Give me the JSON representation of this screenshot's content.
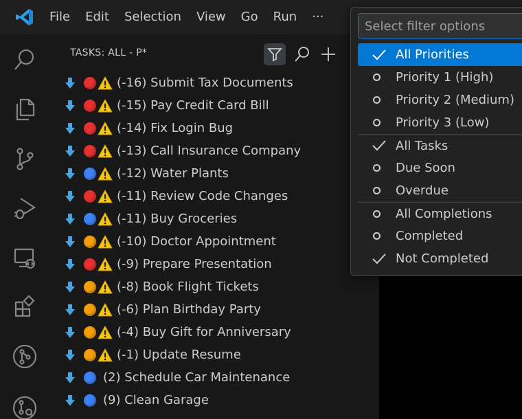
{
  "menubar": {
    "items": [
      "File",
      "Edit",
      "Selection",
      "View",
      "Go",
      "Run",
      "···"
    ]
  },
  "activitybar": {
    "icons": [
      "search-icon",
      "explorer-icon",
      "source-control-icon",
      "run-debug-icon",
      "remote-explorer-icon",
      "extensions-icon",
      "git-graph-icon",
      "git-lens-icon"
    ]
  },
  "sidebar": {
    "title": "TASKS: ALL - P*",
    "actions": [
      "filter-icon",
      "search-icon",
      "add-icon"
    ]
  },
  "colors": {
    "red": "#e8312f",
    "blue": "#3b82f6",
    "orange": "#f59e0b",
    "warning": "#f5c518",
    "arrow": "#4aa3df",
    "accent": "#0078d4"
  },
  "tasks": [
    {
      "priority_color": "red",
      "warning": true,
      "label": "(-16) Submit Tax Documents"
    },
    {
      "priority_color": "red",
      "warning": true,
      "label": "(-15) Pay Credit Card Bill"
    },
    {
      "priority_color": "red",
      "warning": true,
      "label": "(-14) Fix Login Bug"
    },
    {
      "priority_color": "red",
      "warning": true,
      "label": "(-13) Call Insurance Company"
    },
    {
      "priority_color": "blue",
      "warning": true,
      "label": "(-12) Water Plants"
    },
    {
      "priority_color": "red",
      "warning": true,
      "label": "(-11) Review Code Changes"
    },
    {
      "priority_color": "blue",
      "warning": true,
      "label": "(-11) Buy Groceries"
    },
    {
      "priority_color": "orange",
      "warning": true,
      "label": "(-10) Doctor Appointment"
    },
    {
      "priority_color": "red",
      "warning": true,
      "label": "(-9) Prepare Presentation"
    },
    {
      "priority_color": "orange",
      "warning": true,
      "label": "(-8) Book Flight Tickets"
    },
    {
      "priority_color": "orange",
      "warning": true,
      "label": "(-6) Plan Birthday Party"
    },
    {
      "priority_color": "orange",
      "warning": true,
      "label": "(-4) Buy Gift for Anniversary"
    },
    {
      "priority_color": "orange",
      "warning": true,
      "label": "(-1) Update Resume"
    },
    {
      "priority_color": "blue",
      "warning": false,
      "label": "(2) Schedule Car Maintenance"
    },
    {
      "priority_color": "blue",
      "warning": false,
      "label": "(9) Clean Garage"
    }
  ],
  "quickpick": {
    "placeholder": "Select filter options",
    "items": [
      {
        "label": "All Priorities",
        "checked": true,
        "selected": true,
        "separator_before": false
      },
      {
        "label": "Priority 1 (High)",
        "checked": false,
        "selected": false,
        "separator_before": false
      },
      {
        "label": "Priority 2 (Medium)",
        "checked": false,
        "selected": false,
        "separator_before": false
      },
      {
        "label": "Priority 3 (Low)",
        "checked": false,
        "selected": false,
        "separator_before": false
      },
      {
        "label": "All Tasks",
        "checked": true,
        "selected": false,
        "separator_before": true
      },
      {
        "label": "Due Soon",
        "checked": false,
        "selected": false,
        "separator_before": false
      },
      {
        "label": "Overdue",
        "checked": false,
        "selected": false,
        "separator_before": false
      },
      {
        "label": "All Completions",
        "checked": false,
        "selected": false,
        "separator_before": true
      },
      {
        "label": "Completed",
        "checked": false,
        "selected": false,
        "separator_before": false
      },
      {
        "label": "Not Completed",
        "checked": true,
        "selected": false,
        "separator_before": false
      }
    ]
  }
}
